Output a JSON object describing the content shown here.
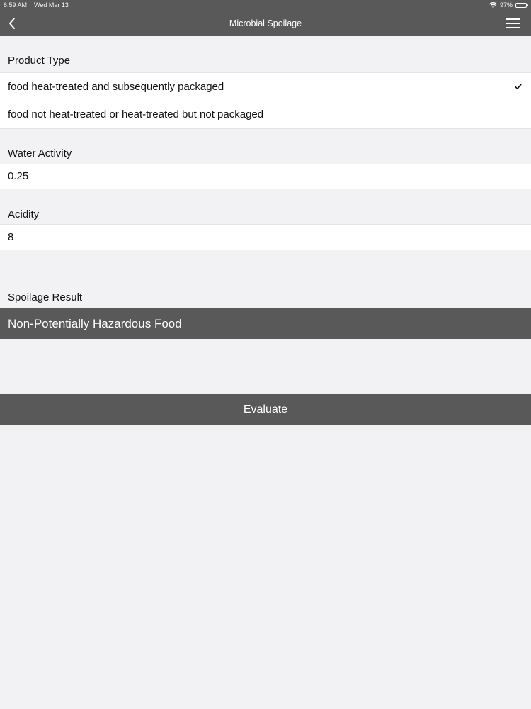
{
  "status_bar": {
    "time": "6:59 AM",
    "date": "Wed Mar 13",
    "battery": "97%",
    "battery_level": 0.97
  },
  "nav": {
    "title": "Microbial Spoilage",
    "back_icon": "chevron-left-icon",
    "menu_icon": "hamburger-menu-icon"
  },
  "product_type": {
    "label": "Product Type",
    "options": [
      {
        "label": "food heat-treated and subsequently packaged",
        "selected": true
      },
      {
        "label": "food not heat-treated or heat-treated but not packaged",
        "selected": false
      }
    ]
  },
  "water_activity": {
    "label": "Water Activity",
    "value": "0.25"
  },
  "acidity": {
    "label": "Acidity",
    "value": "8"
  },
  "spoilage_result": {
    "label": "Spoilage Result",
    "value": "Non-Potentially Hazardous Food"
  },
  "evaluate_button": {
    "label": "Evaluate"
  },
  "colors": {
    "bar": "#5a595a",
    "background": "#f2f2f4",
    "row": "#ffffff"
  }
}
